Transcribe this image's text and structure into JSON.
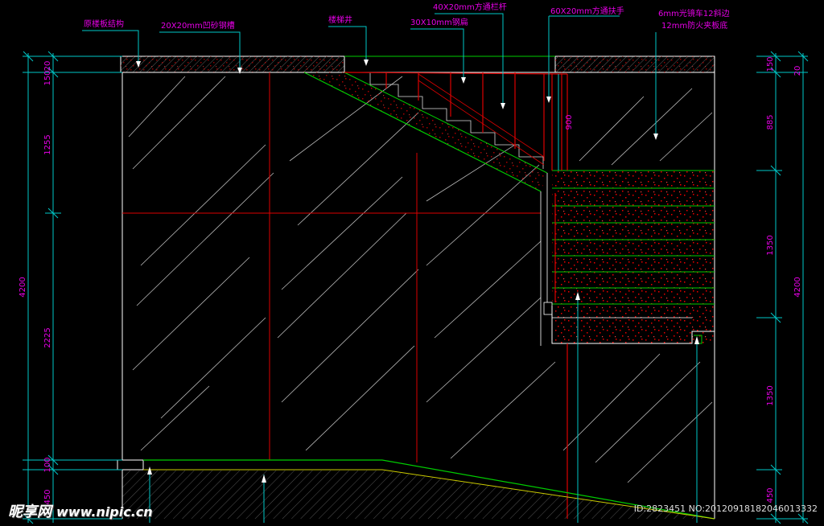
{
  "labels": {
    "original_structure": "原楼板结构",
    "sand_channel": "20X20mm凹砂钢槽",
    "stairwell": "楼梯井",
    "balustrade": "40X20mm方通栏杆",
    "steel_flat": "30X10mm钢扁",
    "handrail": "60X20mm方通扶手",
    "glass_line1": "6mm光镜车12斜边",
    "glass_line2": "12mm防火夹板底"
  },
  "dimensions": {
    "left": [
      "20",
      "150",
      "1255",
      "2225",
      "100",
      "450"
    ],
    "left_total": "4200",
    "right_inner": [
      "150",
      "1350",
      "1350",
      "450"
    ],
    "right_outer": [
      "20",
      "885"
    ],
    "right_total": "4200",
    "rail_height": "900"
  },
  "colors": {
    "label": "#e600e6",
    "dimension_line": "#00c8c8",
    "structure": "#ffffff",
    "guide_red": "#dd0000",
    "stair_green": "#00cc00",
    "slope_yellow": "#cccc00"
  },
  "watermark": {
    "brand": "昵享网",
    "url": "www.nipic.cn",
    "id_text": "ID:2823451 NO:20120918182046013332"
  }
}
